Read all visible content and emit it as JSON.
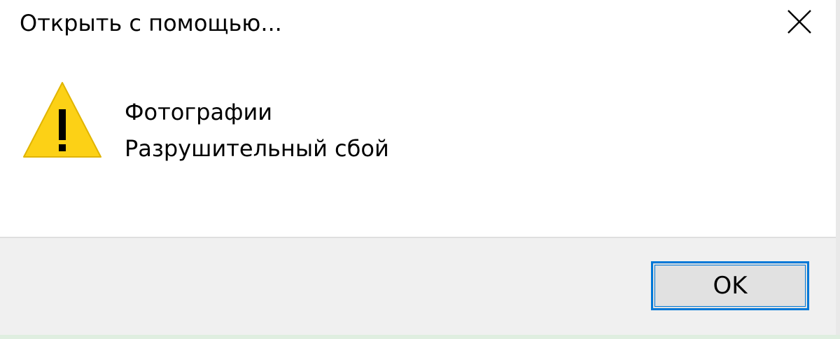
{
  "dialog": {
    "title": "Открыть с помощью...",
    "close_icon": "close-icon",
    "message": {
      "icon": "warning-icon",
      "line1": "Фотографии",
      "line2": "Разрушительный сбой"
    },
    "ok_label": "OK"
  },
  "colors": {
    "accent": "#0078d7",
    "warning_fill": "#fcd116",
    "footer_bg": "#f0f0f0",
    "button_bg": "#e1e1e1"
  }
}
